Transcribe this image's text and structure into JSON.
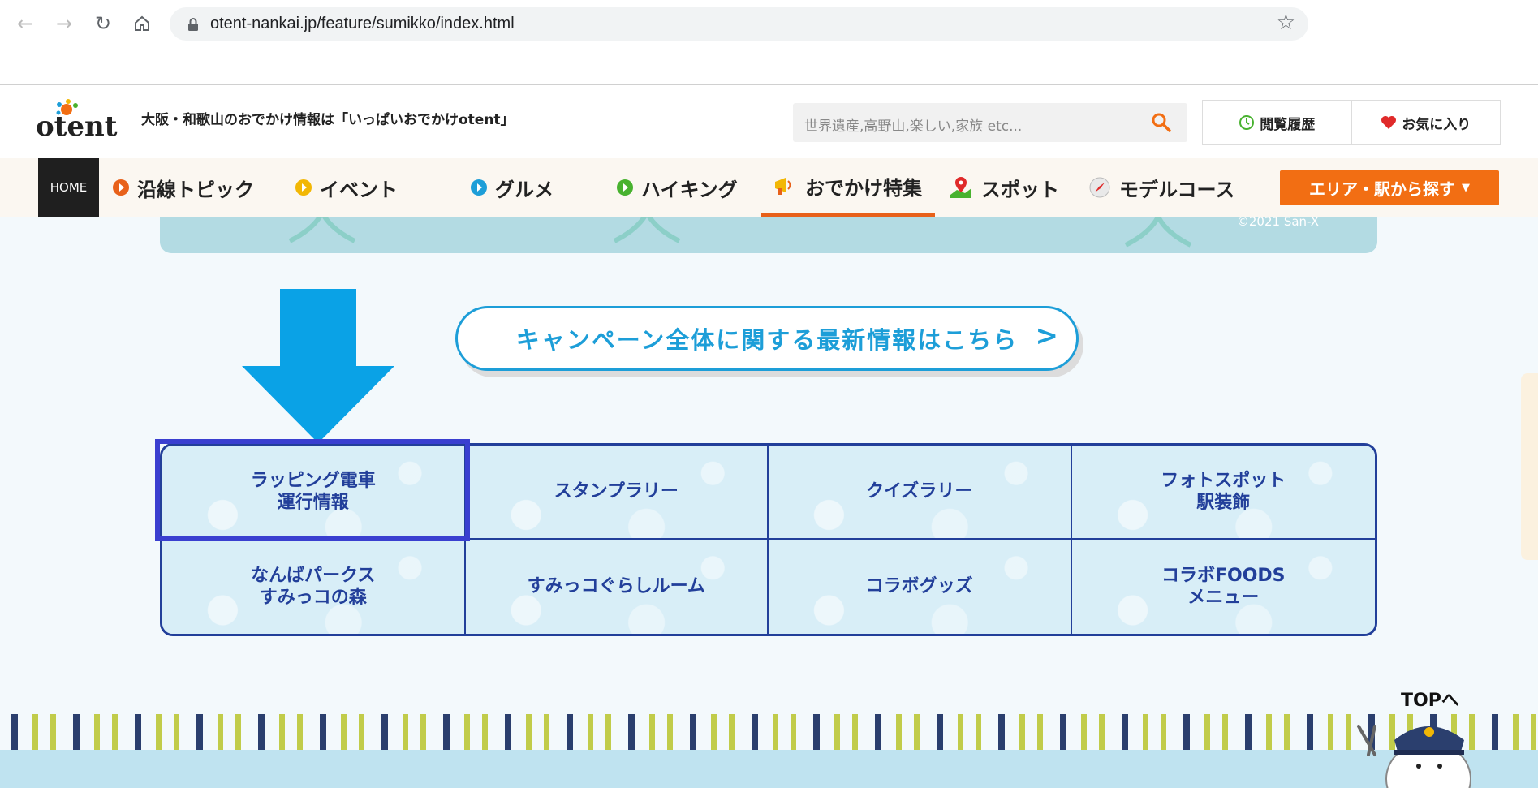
{
  "browser": {
    "url": "otent-nankai.jp/feature/sumikko/index.html"
  },
  "header": {
    "logo_text": "otent",
    "tagline": "大阪・和歌山のおでかけ情報は「いっぱいおでかけotent」",
    "search_placeholder": "世界遺産,高野山,楽しい,家族 etc...",
    "history_label": "閲覧履歴",
    "favorites_label": "お気に入り"
  },
  "nav": {
    "home": "HOME",
    "items": [
      {
        "label": "沿線トピック",
        "color": "#e8611a"
      },
      {
        "label": "イベント",
        "color": "#f2b705"
      },
      {
        "label": "グルメ",
        "color": "#1d9ed8"
      },
      {
        "label": "ハイキング",
        "color": "#48b22f"
      },
      {
        "label": "おでかけ特集",
        "icon": "megaphone-icon"
      },
      {
        "label": "スポット",
        "icon": "map-pin-icon"
      },
      {
        "label": "モデルコース",
        "icon": "compass-icon"
      }
    ],
    "area_button": "エリア・駅から探す"
  },
  "banner": {
    "copyright": "©2021 San-X"
  },
  "campaign": {
    "label": "キャンペーン全体に関する最新情報はこちら",
    "chevron": ">"
  },
  "grid": {
    "cells": [
      "ラッピング電車\n運行情報",
      "スタンプラリー",
      "クイズラリー",
      "フォトスポット\n駅装飾",
      "なんばパークス\nすみっコの森",
      "すみっコぐらしルーム",
      "コラボグッズ",
      "コラボFOODS\nメニュー"
    ]
  },
  "footer": {
    "to_top": "TOPへ"
  },
  "colors": {
    "accent_orange": "#f26e13",
    "campaign_blue": "#1d9ed8",
    "grid_navy": "#223f9a",
    "highlight": "#3a3fd0"
  }
}
